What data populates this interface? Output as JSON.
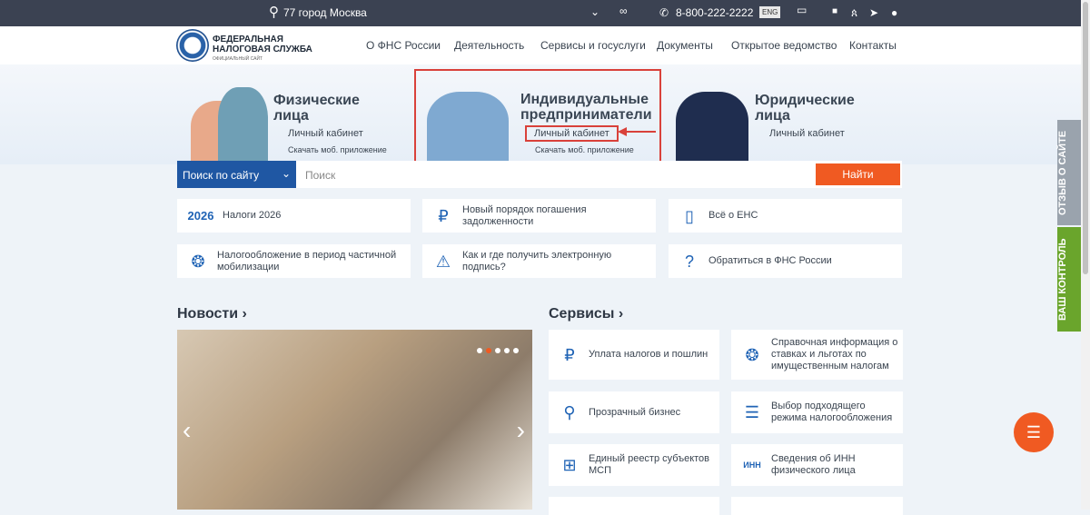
{
  "topbar": {
    "city": "77 город Москва",
    "phone": "8-800-222-2222",
    "lang": "ENG"
  },
  "logo": {
    "line1": "ФЕДЕРАЛЬНАЯ",
    "line2": "НАЛОГОВАЯ СЛУЖБА",
    "line3": "ОФИЦИАЛЬНЫЙ САЙТ"
  },
  "nav": [
    "О ФНС России",
    "Деятельность",
    "Сервисы и госуслуги",
    "Документы",
    "Открытое ведомство",
    "Контакты"
  ],
  "hero": {
    "fiz": {
      "title1": "Физические",
      "title2": "лица",
      "link": "Личный кабинет",
      "app": "Скачать моб. приложение"
    },
    "ip": {
      "title1": "Индивидуальные",
      "title2": "предприниматели",
      "link": "Личный кабинет",
      "app": "Скачать моб. приложение"
    },
    "yur": {
      "title1": "Юридические",
      "title2": "лица",
      "link": "Личный кабинет"
    }
  },
  "search": {
    "select": "Поиск по сайту",
    "placeholder": "Поиск",
    "button": "Найти"
  },
  "quick": [
    {
      "text": "Налоги 2026",
      "icon": "2026"
    },
    {
      "text": "Новый порядок погашения задолженности",
      "icon": "₽"
    },
    {
      "text": "Всё о ЕНС",
      "icon": "▯"
    },
    {
      "text": "Налогообложение в период частичной мобилизации",
      "icon": "❂"
    },
    {
      "text": "Как и где получить электронную подпись?",
      "icon": "⚠"
    },
    {
      "text": "Обратиться в ФНС России",
      "icon": "?"
    }
  ],
  "news": {
    "title": "Новости ›"
  },
  "services": {
    "title": "Сервисы ›",
    "items": [
      {
        "text": "Уплата налогов и пошлин",
        "icon": "₽"
      },
      {
        "text": "Справочная информация о ставках и льготах по имущественным налогам",
        "icon": "❂"
      },
      {
        "text": "Прозрачный бизнес",
        "icon": "⚲"
      },
      {
        "text": "Выбор подходящего режима налогообложения",
        "icon": "☰"
      },
      {
        "text": "Единый реестр субъектов МСП",
        "icon": "⊞"
      },
      {
        "text": "Сведения об ИНН физического лица",
        "icon": "ИНН"
      }
    ]
  },
  "side": {
    "feedback": "ОТЗЫВ О САЙТЕ",
    "control": "ВАШ КОНТРОЛЬ"
  },
  "colors": {
    "accent": "#f05a22",
    "blue": "#1f57a3",
    "green": "#6aa52c",
    "gray": "#9aa3ad"
  }
}
